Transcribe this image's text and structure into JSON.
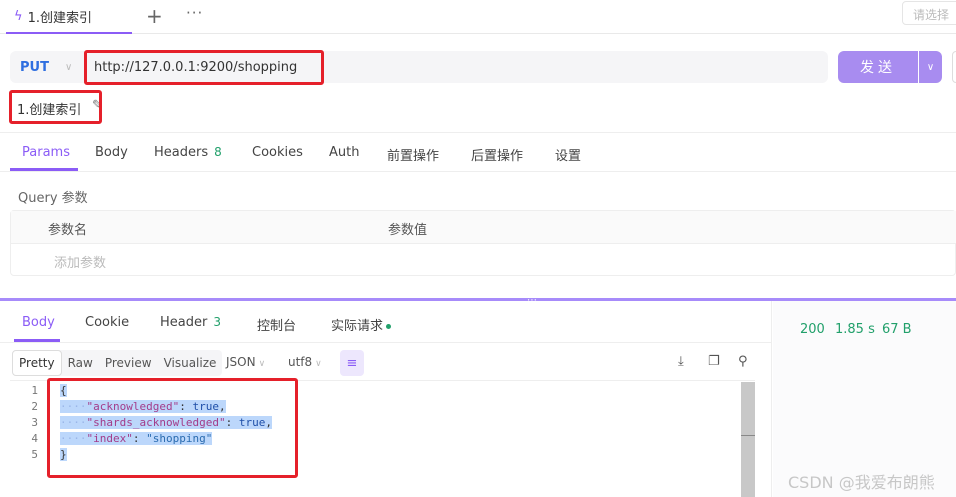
{
  "tabbar": {
    "tab_label": "1.创建索引",
    "env_placeholder": "请选择"
  },
  "request": {
    "method": "PUT",
    "url": "http://127.0.0.1:9200/shopping",
    "send_label": "发送",
    "name": "1.创建索引"
  },
  "req_tabs": [
    {
      "label": "Params"
    },
    {
      "label": "Body"
    },
    {
      "label": "Headers",
      "badge": "8"
    },
    {
      "label": "Cookies"
    },
    {
      "label": "Auth"
    },
    {
      "label": "前置操作"
    },
    {
      "label": "后置操作"
    },
    {
      "label": "设置"
    }
  ],
  "query": {
    "section_label": "Query 参数",
    "col_name": "参数名",
    "col_value": "参数值",
    "add_placeholder": "添加参数"
  },
  "response": {
    "tabs": [
      {
        "label": "Body"
      },
      {
        "label": "Cookie"
      },
      {
        "label": "Header",
        "badge": "3"
      },
      {
        "label": "控制台"
      },
      {
        "label": "实际请求"
      }
    ],
    "view_modes": [
      "Pretty",
      "Raw",
      "Preview",
      "Visualize"
    ],
    "format": "JSON",
    "encoding": "utf8",
    "status_code": "200",
    "time": "1.85 s",
    "size": "67 B",
    "code_lines": [
      {
        "num": "1",
        "text": "{"
      },
      {
        "num": "2",
        "key": "\"acknowledged\"",
        "sep": ": ",
        "val": "true",
        "end": ","
      },
      {
        "num": "3",
        "key": "\"shards_acknowledged\"",
        "sep": ": ",
        "val": "true",
        "end": ","
      },
      {
        "num": "4",
        "key": "\"index\"",
        "sep": ": ",
        "val": "\"shopping\"",
        "end": ""
      },
      {
        "num": "5",
        "text": "}"
      }
    ]
  },
  "watermark": "CSDN @我爱布朗熊",
  "colors": {
    "accent": "#8b5cf6",
    "send_button": "#a88cf0",
    "success": "#22a06b",
    "annotation_red": "#e5202a"
  }
}
